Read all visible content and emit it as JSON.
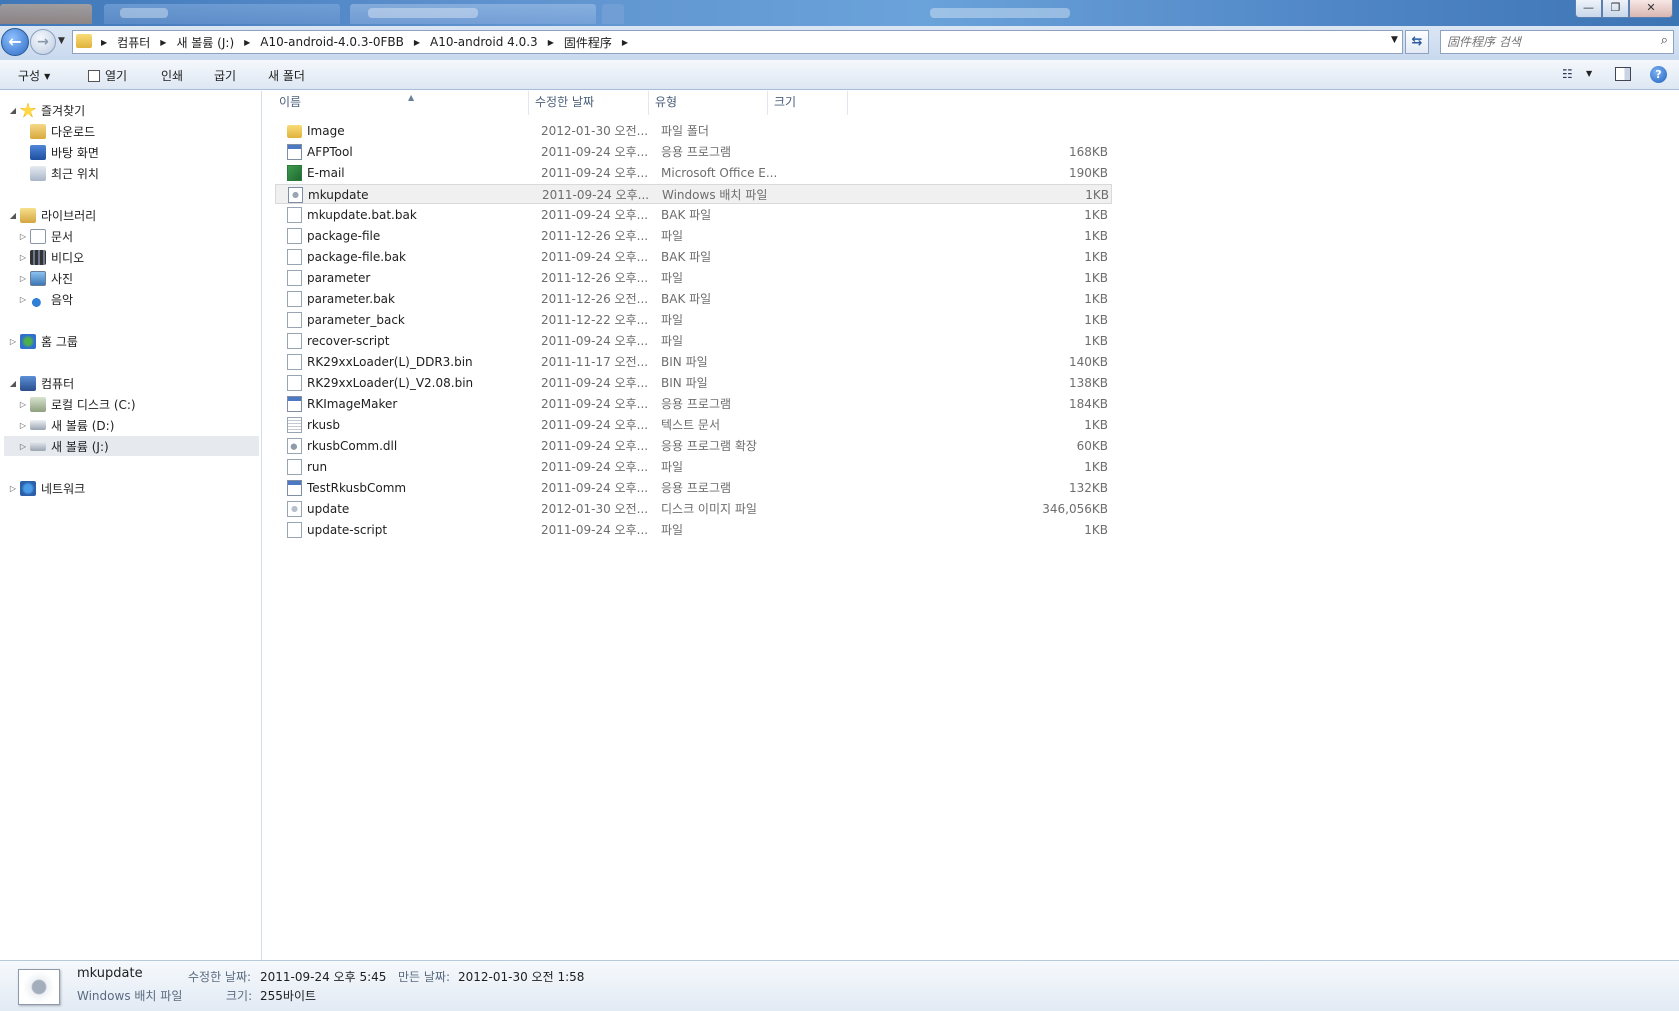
{
  "titlebar": {
    "controls": {
      "minimize": "—",
      "maximize": "❐",
      "close": "✕"
    }
  },
  "address": {
    "back_icon": "←",
    "forward_icon": "→",
    "crumbs": [
      "컴퓨터",
      "새 볼륨 (J:)",
      "A10-android-4.0.3-0FBB",
      "A10-android 4.0.3",
      "固件程序"
    ],
    "search_placeholder": "固件程序 검색"
  },
  "toolbar": {
    "organize": "구성",
    "open": "열기",
    "print": "인쇄",
    "burn": "굽기",
    "new_folder": "새 폴더",
    "help": "?"
  },
  "nav": {
    "favorites": "즐겨찾기",
    "downloads": "다운로드",
    "desktop": "바탕 화면",
    "recent": "최근 위치",
    "libraries": "라이브러리",
    "documents": "문서",
    "videos": "비디오",
    "pictures": "사진",
    "music": "음악",
    "homegroup": "홈 그룹",
    "computer": "컴퓨터",
    "local_c": "로컬 디스크 (C:)",
    "vol_d": "새 볼륨 (D:)",
    "vol_j": "새 볼륨 (J:)",
    "network": "네트워크"
  },
  "columns": {
    "name": "이름",
    "date": "수정한 날짜",
    "type": "유형",
    "size": "크기"
  },
  "files": [
    {
      "name": "Image",
      "date": "2012-01-30 오전...",
      "type": "파일 폴더",
      "size": "",
      "icon": "folder-icon"
    },
    {
      "name": "AFPTool",
      "date": "2011-09-24 오후...",
      "type": "응용 프로그램",
      "size": "168KB",
      "icon": "application-icon"
    },
    {
      "name": "E-mail",
      "date": "2011-09-24 오후...",
      "type": "Microsoft Office E...",
      "size": "190KB",
      "icon": "excel-file-icon"
    },
    {
      "name": "mkupdate",
      "date": "2011-09-24 오후...",
      "type": "Windows 배치 파일",
      "size": "1KB",
      "icon": "batch-file-icon"
    },
    {
      "name": "mkupdate.bat.bak",
      "date": "2011-09-24 오후...",
      "type": "BAK 파일",
      "size": "1KB",
      "icon": "file-icon"
    },
    {
      "name": "package-file",
      "date": "2011-12-26 오후...",
      "type": "파일",
      "size": "1KB",
      "icon": "file-icon"
    },
    {
      "name": "package-file.bak",
      "date": "2011-09-24 오후...",
      "type": "BAK 파일",
      "size": "1KB",
      "icon": "file-icon"
    },
    {
      "name": "parameter",
      "date": "2011-12-26 오후...",
      "type": "파일",
      "size": "1KB",
      "icon": "file-icon"
    },
    {
      "name": "parameter.bak",
      "date": "2011-12-26 오전...",
      "type": "BAK 파일",
      "size": "1KB",
      "icon": "file-icon"
    },
    {
      "name": "parameter_back",
      "date": "2011-12-22 오후...",
      "type": "파일",
      "size": "1KB",
      "icon": "file-icon"
    },
    {
      "name": "recover-script",
      "date": "2011-09-24 오후...",
      "type": "파일",
      "size": "1KB",
      "icon": "file-icon"
    },
    {
      "name": "RK29xxLoader(L)_DDR3.bin",
      "date": "2011-11-17 오전...",
      "type": "BIN 파일",
      "size": "140KB",
      "icon": "file-icon"
    },
    {
      "name": "RK29xxLoader(L)_V2.08.bin",
      "date": "2011-09-24 오후...",
      "type": "BIN 파일",
      "size": "138KB",
      "icon": "file-icon"
    },
    {
      "name": "RKImageMaker",
      "date": "2011-09-24 오후...",
      "type": "응용 프로그램",
      "size": "184KB",
      "icon": "application-icon"
    },
    {
      "name": "rkusb",
      "date": "2011-09-24 오후...",
      "type": "텍스트 문서",
      "size": "1KB",
      "icon": "text-file-icon"
    },
    {
      "name": "rkusbComm.dll",
      "date": "2011-09-24 오후...",
      "type": "응용 프로그램 확장",
      "size": "60KB",
      "icon": "dll-file-icon"
    },
    {
      "name": "run",
      "date": "2011-09-24 오후...",
      "type": "파일",
      "size": "1KB",
      "icon": "file-icon"
    },
    {
      "name": "TestRkusbComm",
      "date": "2011-09-24 오후...",
      "type": "응용 프로그램",
      "size": "132KB",
      "icon": "application-icon"
    },
    {
      "name": "update",
      "date": "2012-01-30 오전...",
      "type": "디스크 이미지 파일",
      "size": "346,056KB",
      "icon": "disk-image-icon"
    },
    {
      "name": "update-script",
      "date": "2011-09-24 오후...",
      "type": "파일",
      "size": "1KB",
      "icon": "file-icon"
    }
  ],
  "details": {
    "name": "mkupdate",
    "type": "Windows 배치 파일",
    "modified_label": "수정한 날짜:",
    "modified_value": "2011-09-24 오후 5:45",
    "created_label": "만든 날짜:",
    "created_value": "2012-01-30 오전 1:58",
    "size_label": "크기:",
    "size_value": "255바이트"
  }
}
